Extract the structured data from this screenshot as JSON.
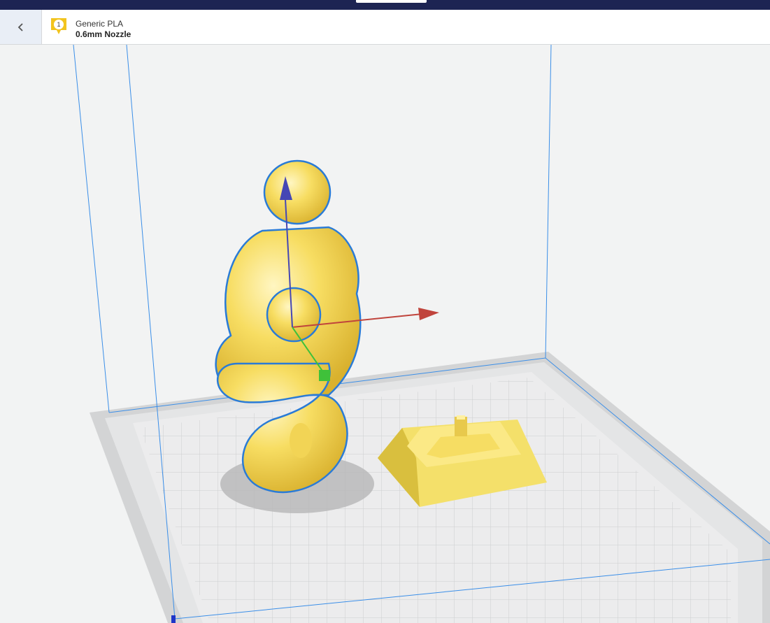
{
  "header": {
    "extruder_number": "1",
    "material": "Generic PLA",
    "nozzle": "0.6mm Nozzle"
  },
  "icons": {
    "back": "chevron-left-icon",
    "extruder": "extruder-badge-icon"
  },
  "colors": {
    "title_bar": "#1d2453",
    "model": "#f7d95a",
    "selection_outline": "#2a7bd6",
    "axis_x": "#c0443c",
    "axis_y": "#3fc13a",
    "axis_z": "#4547b5",
    "build_volume_line": "#3a8ee8"
  }
}
